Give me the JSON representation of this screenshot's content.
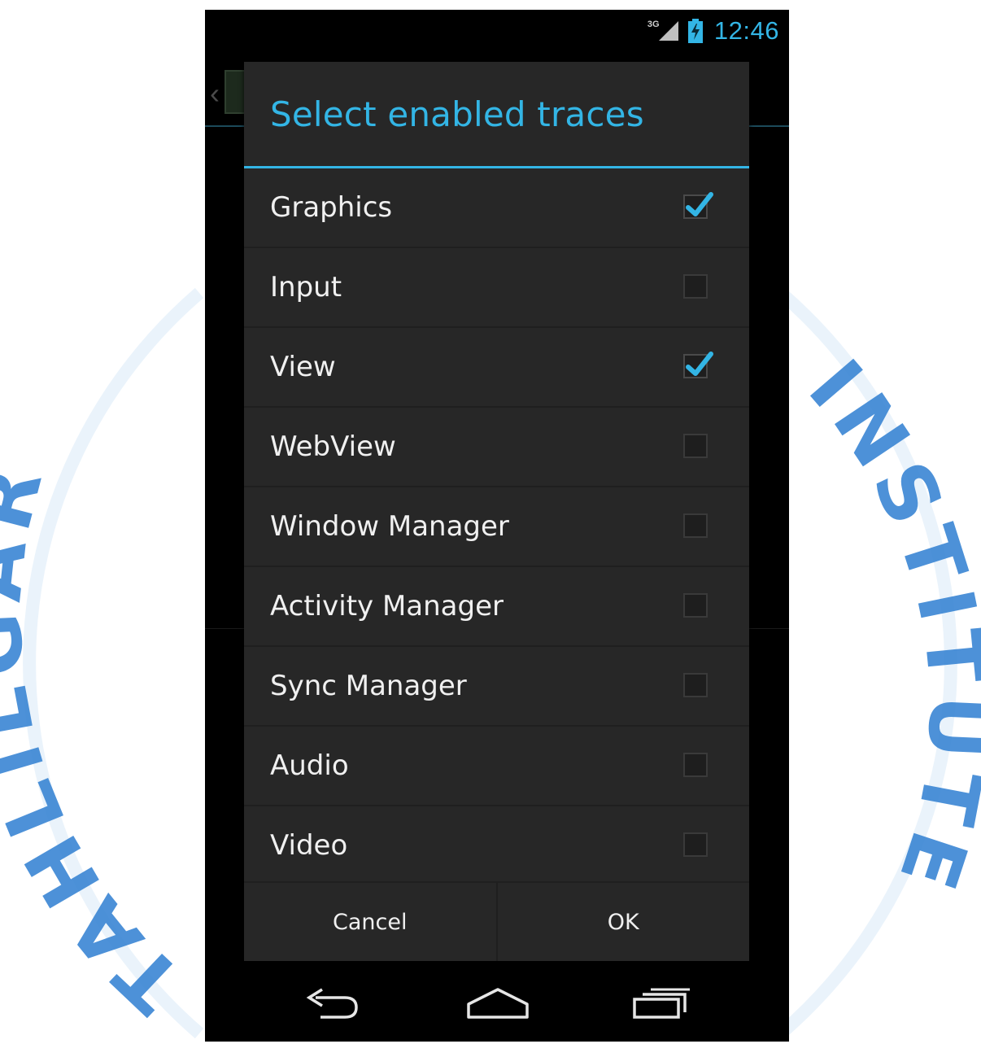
{
  "status_bar": {
    "network": "3G",
    "time": "12:46"
  },
  "dialog": {
    "title": "Select enabled traces",
    "items": [
      {
        "label": "Graphics",
        "checked": true
      },
      {
        "label": "Input",
        "checked": false
      },
      {
        "label": "View",
        "checked": true
      },
      {
        "label": "WebView",
        "checked": false
      },
      {
        "label": "Window Manager",
        "checked": false
      },
      {
        "label": "Activity Manager",
        "checked": false
      },
      {
        "label": "Sync Manager",
        "checked": false
      },
      {
        "label": "Audio",
        "checked": false
      },
      {
        "label": "Video",
        "checked": false
      }
    ],
    "cancel_label": "Cancel",
    "ok_label": "OK"
  },
  "navigation": {
    "icons": [
      "back-icon",
      "home-icon",
      "recent-apps-icon"
    ]
  },
  "watermark": {
    "text_left": "TAHLILGAR",
    "text_right": "INSTITUTE",
    "color": "#3a86d4"
  },
  "colors": {
    "accent": "#33b5e5",
    "dialog_bg": "#272727",
    "text": "#f0f0f0"
  }
}
